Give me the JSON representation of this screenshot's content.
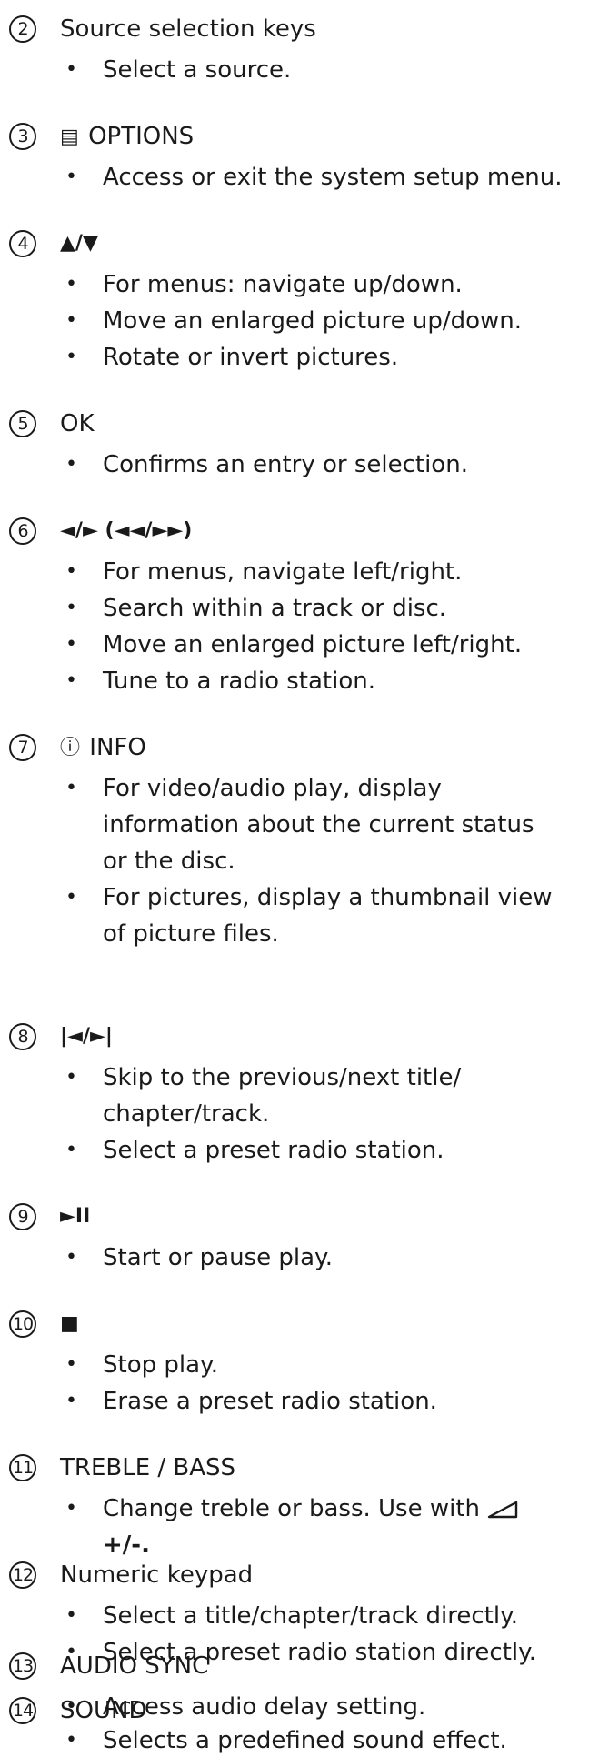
{
  "sections": [
    {
      "num": "2",
      "title": "Source selection keys",
      "items": [
        "Select a source."
      ]
    },
    {
      "num": "3",
      "icon": "options-icon",
      "icon_glyph": "▤",
      "title": "OPTIONS",
      "items": [
        "Access or exit the system setup menu."
      ]
    },
    {
      "num": "4",
      "title": "▲/▼",
      "items": [
        "For menus: navigate up/down.",
        "Move an enlarged picture up/down.",
        "Rotate or invert pictures."
      ]
    },
    {
      "num": "5",
      "title": "OK",
      "items": [
        "Confirms an entry or selection."
      ]
    },
    {
      "num": "6",
      "title": "◄/► (◄◄/►►)",
      "items": [
        "For menus, navigate left/right.",
        "Search within a track or disc.",
        "Move an enlarged picture left/right.",
        "Tune to a radio station."
      ]
    },
    {
      "num": "7",
      "icon": "info-icon",
      "icon_glyph": "ⓘ",
      "title": "INFO",
      "items": [
        "For video/audio play, display",
        "information about the current status",
        "or the disc.",
        "For pictures, display a thumbnail view",
        "of picture files."
      ]
    },
    {
      "num": "8",
      "title": "|◄/►|",
      "items": [
        "Skip to the previous/next title/",
        "chapter/track.",
        "Select a preset radio station."
      ]
    },
    {
      "num": "9",
      "title": "►II",
      "items": [
        "Start or pause play."
      ]
    },
    {
      "num": "10",
      "title": "■",
      "items": [
        "Stop play.",
        "Erase a preset radio station."
      ]
    },
    {
      "num": "11",
      "title": "TREBLE / BASS",
      "items": [
        "Change treble or bass. Use with",
        "+/-."
      ]
    },
    {
      "num": "12",
      "title": "Numeric keypad",
      "items": [
        "Select a title/chapter/track directly.",
        "Select a preset radio station directly."
      ]
    },
    {
      "num": "13",
      "title": "AUDIO SYNC",
      "items": [
        "Access audio delay setting."
      ]
    },
    {
      "num": "14",
      "title": "SOUND",
      "items": [
        "Selects a predefined sound effect."
      ]
    }
  ],
  "bullet_char": "•"
}
